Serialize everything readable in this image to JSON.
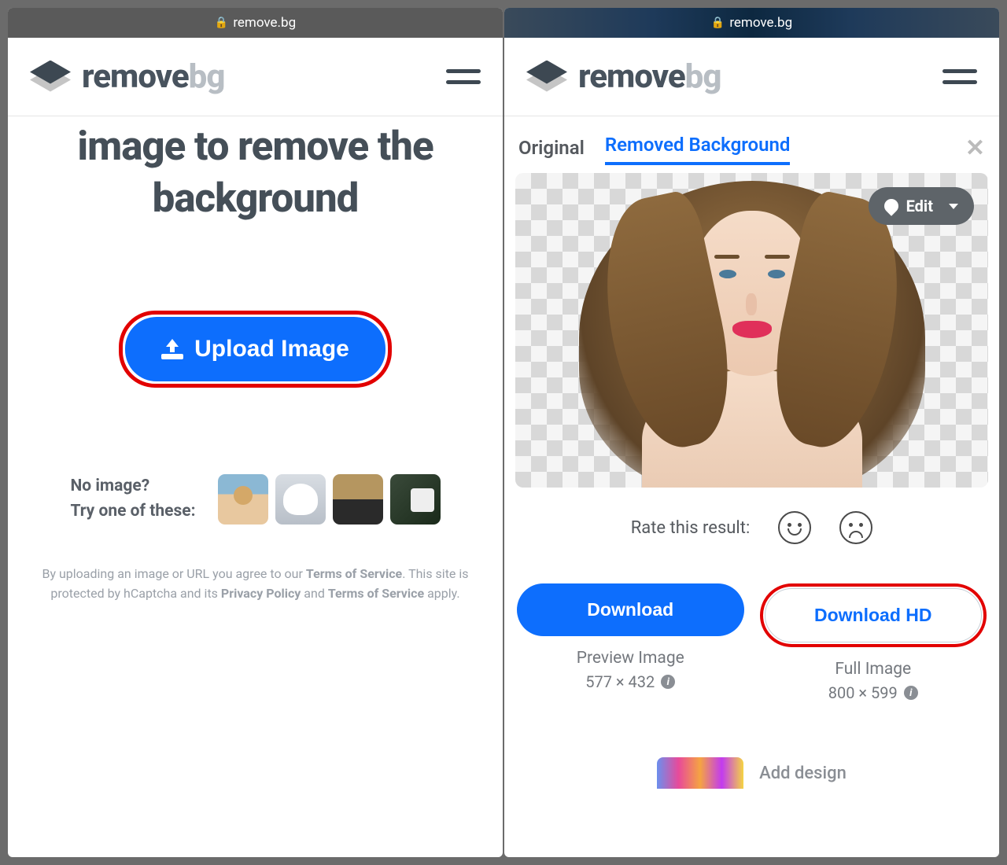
{
  "url": "remove.bg",
  "logo": {
    "part1": "remove",
    "part2": "bg"
  },
  "left": {
    "hero": "image to remove the background",
    "upload_label": "Upload Image",
    "no_image_line1": "No image?",
    "no_image_line2": "Try one of these:",
    "legal_pre": "By uploading an image or URL you agree to our ",
    "legal_tos": "Terms of Service",
    "legal_mid": ". This site is protected by hCaptcha and its ",
    "legal_pp": "Privacy Policy",
    "legal_and": " and ",
    "legal_tos2": "Terms of Service",
    "legal_end": " apply."
  },
  "right": {
    "tab_original": "Original",
    "tab_removed": "Removed Background",
    "edit_label": "Edit",
    "rate_label": "Rate this result:",
    "download": {
      "primary_label": "Download",
      "primary_meta1": "Preview Image",
      "primary_meta2": "577 × 432",
      "hd_label": "Download HD",
      "hd_meta1": "Full Image",
      "hd_meta2": "800 × 599"
    },
    "add_design": "Add design"
  }
}
